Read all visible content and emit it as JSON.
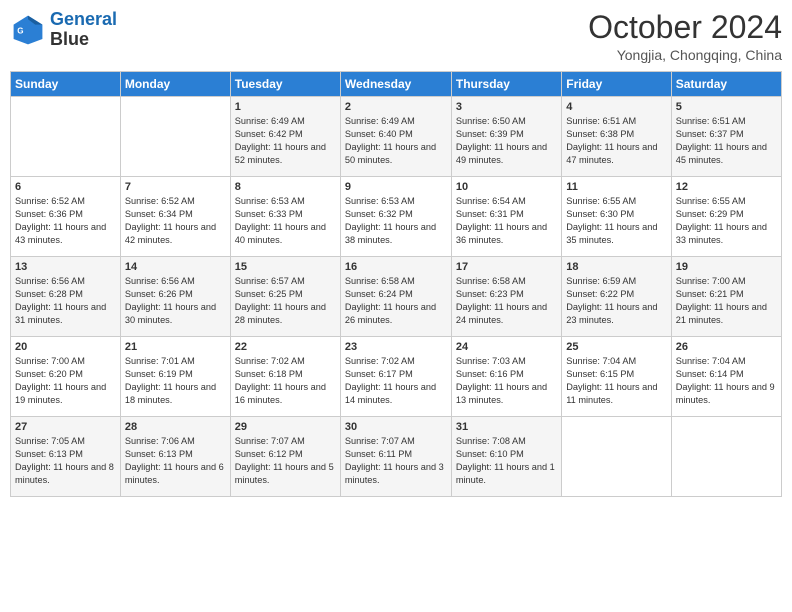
{
  "logo": {
    "line1": "General",
    "line2": "Blue"
  },
  "title": "October 2024",
  "subtitle": "Yongjia, Chongqing, China",
  "headers": [
    "Sunday",
    "Monday",
    "Tuesday",
    "Wednesday",
    "Thursday",
    "Friday",
    "Saturday"
  ],
  "weeks": [
    [
      {
        "day": "",
        "text": ""
      },
      {
        "day": "",
        "text": ""
      },
      {
        "day": "1",
        "text": "Sunrise: 6:49 AM\nSunset: 6:42 PM\nDaylight: 11 hours and 52 minutes."
      },
      {
        "day": "2",
        "text": "Sunrise: 6:49 AM\nSunset: 6:40 PM\nDaylight: 11 hours and 50 minutes."
      },
      {
        "day": "3",
        "text": "Sunrise: 6:50 AM\nSunset: 6:39 PM\nDaylight: 11 hours and 49 minutes."
      },
      {
        "day": "4",
        "text": "Sunrise: 6:51 AM\nSunset: 6:38 PM\nDaylight: 11 hours and 47 minutes."
      },
      {
        "day": "5",
        "text": "Sunrise: 6:51 AM\nSunset: 6:37 PM\nDaylight: 11 hours and 45 minutes."
      }
    ],
    [
      {
        "day": "6",
        "text": "Sunrise: 6:52 AM\nSunset: 6:36 PM\nDaylight: 11 hours and 43 minutes."
      },
      {
        "day": "7",
        "text": "Sunrise: 6:52 AM\nSunset: 6:34 PM\nDaylight: 11 hours and 42 minutes."
      },
      {
        "day": "8",
        "text": "Sunrise: 6:53 AM\nSunset: 6:33 PM\nDaylight: 11 hours and 40 minutes."
      },
      {
        "day": "9",
        "text": "Sunrise: 6:53 AM\nSunset: 6:32 PM\nDaylight: 11 hours and 38 minutes."
      },
      {
        "day": "10",
        "text": "Sunrise: 6:54 AM\nSunset: 6:31 PM\nDaylight: 11 hours and 36 minutes."
      },
      {
        "day": "11",
        "text": "Sunrise: 6:55 AM\nSunset: 6:30 PM\nDaylight: 11 hours and 35 minutes."
      },
      {
        "day": "12",
        "text": "Sunrise: 6:55 AM\nSunset: 6:29 PM\nDaylight: 11 hours and 33 minutes."
      }
    ],
    [
      {
        "day": "13",
        "text": "Sunrise: 6:56 AM\nSunset: 6:28 PM\nDaylight: 11 hours and 31 minutes."
      },
      {
        "day": "14",
        "text": "Sunrise: 6:56 AM\nSunset: 6:26 PM\nDaylight: 11 hours and 30 minutes."
      },
      {
        "day": "15",
        "text": "Sunrise: 6:57 AM\nSunset: 6:25 PM\nDaylight: 11 hours and 28 minutes."
      },
      {
        "day": "16",
        "text": "Sunrise: 6:58 AM\nSunset: 6:24 PM\nDaylight: 11 hours and 26 minutes."
      },
      {
        "day": "17",
        "text": "Sunrise: 6:58 AM\nSunset: 6:23 PM\nDaylight: 11 hours and 24 minutes."
      },
      {
        "day": "18",
        "text": "Sunrise: 6:59 AM\nSunset: 6:22 PM\nDaylight: 11 hours and 23 minutes."
      },
      {
        "day": "19",
        "text": "Sunrise: 7:00 AM\nSunset: 6:21 PM\nDaylight: 11 hours and 21 minutes."
      }
    ],
    [
      {
        "day": "20",
        "text": "Sunrise: 7:00 AM\nSunset: 6:20 PM\nDaylight: 11 hours and 19 minutes."
      },
      {
        "day": "21",
        "text": "Sunrise: 7:01 AM\nSunset: 6:19 PM\nDaylight: 11 hours and 18 minutes."
      },
      {
        "day": "22",
        "text": "Sunrise: 7:02 AM\nSunset: 6:18 PM\nDaylight: 11 hours and 16 minutes."
      },
      {
        "day": "23",
        "text": "Sunrise: 7:02 AM\nSunset: 6:17 PM\nDaylight: 11 hours and 14 minutes."
      },
      {
        "day": "24",
        "text": "Sunrise: 7:03 AM\nSunset: 6:16 PM\nDaylight: 11 hours and 13 minutes."
      },
      {
        "day": "25",
        "text": "Sunrise: 7:04 AM\nSunset: 6:15 PM\nDaylight: 11 hours and 11 minutes."
      },
      {
        "day": "26",
        "text": "Sunrise: 7:04 AM\nSunset: 6:14 PM\nDaylight: 11 hours and 9 minutes."
      }
    ],
    [
      {
        "day": "27",
        "text": "Sunrise: 7:05 AM\nSunset: 6:13 PM\nDaylight: 11 hours and 8 minutes."
      },
      {
        "day": "28",
        "text": "Sunrise: 7:06 AM\nSunset: 6:13 PM\nDaylight: 11 hours and 6 minutes."
      },
      {
        "day": "29",
        "text": "Sunrise: 7:07 AM\nSunset: 6:12 PM\nDaylight: 11 hours and 5 minutes."
      },
      {
        "day": "30",
        "text": "Sunrise: 7:07 AM\nSunset: 6:11 PM\nDaylight: 11 hours and 3 minutes."
      },
      {
        "day": "31",
        "text": "Sunrise: 7:08 AM\nSunset: 6:10 PM\nDaylight: 11 hours and 1 minute."
      },
      {
        "day": "",
        "text": ""
      },
      {
        "day": "",
        "text": ""
      }
    ]
  ]
}
